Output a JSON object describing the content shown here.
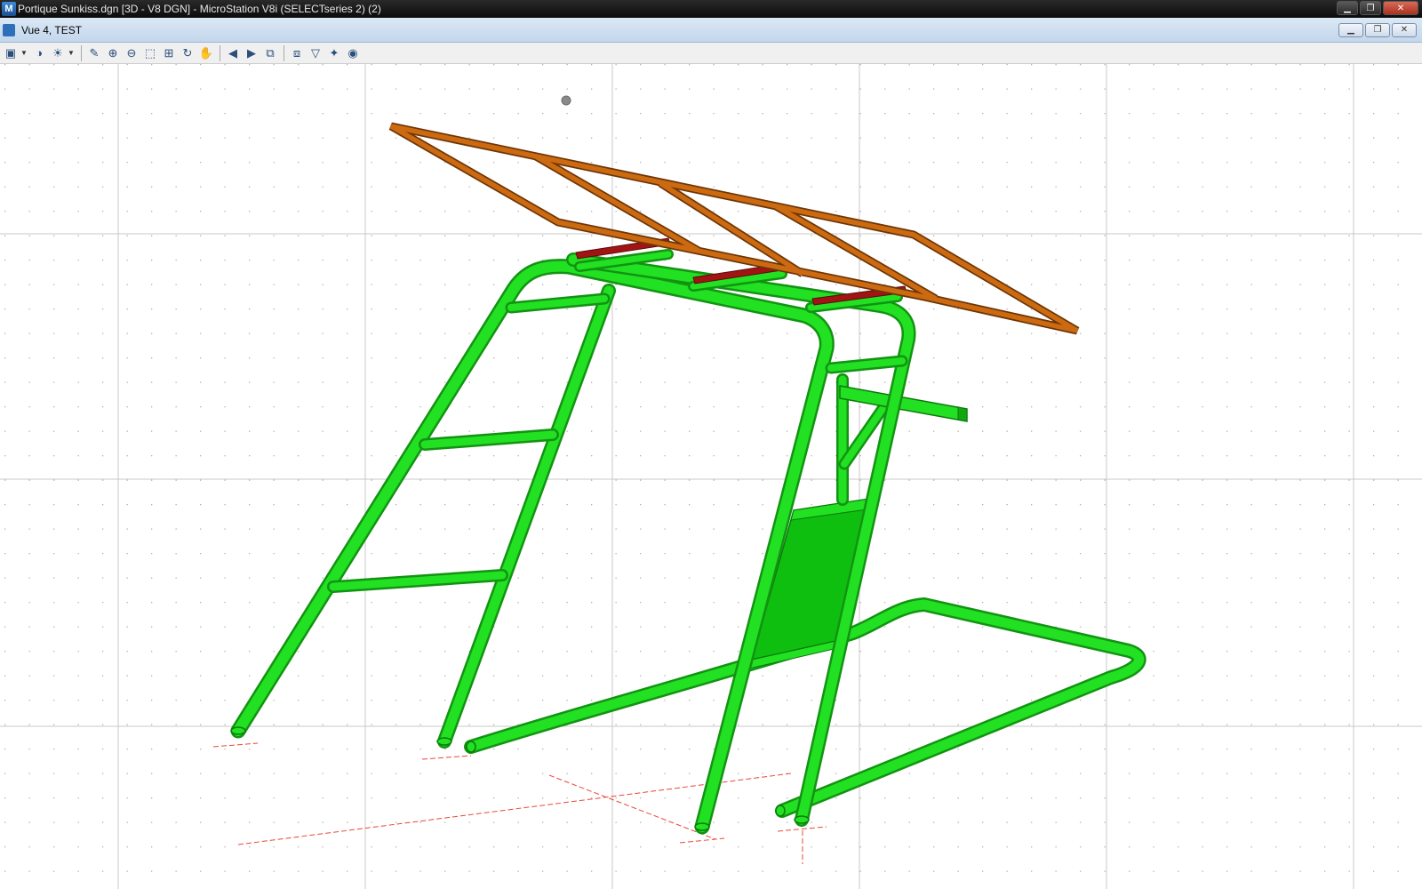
{
  "app": {
    "title": "Portique Sunkiss.dgn [3D - V8 DGN] - MicroStation V8i (SELECTseries 2) (2)",
    "icon": "microstation-logo-icon",
    "window_controls": [
      "minimize-icon",
      "restore-icon",
      "close-icon"
    ]
  },
  "view": {
    "title": "Vue 4, TEST",
    "icon": "view-window-icon",
    "window_controls": [
      "minimize-icon",
      "restore-icon",
      "close-icon"
    ]
  },
  "toolbar": {
    "tools": [
      "view-attributes-icon",
      "display-style-icon",
      "lighting-icon",
      "update-view-icon",
      "zoom-in-icon",
      "zoom-out-icon",
      "window-area-icon",
      "fit-view-icon",
      "rotate-view-icon",
      "pan-view-icon",
      "view-previous-icon",
      "view-next-icon",
      "copy-view-icon",
      "clip-volume-icon",
      "clip-mask-icon",
      "camera-icon",
      "render-icon"
    ]
  },
  "colors": {
    "frame_tube": "#22e022",
    "frame_tube_shade": "#129412",
    "roof_frame": "#cc6a12",
    "roof_bracket": "#a01414",
    "construction_lines": "#e8473a",
    "grid_major": "#c8c8c8",
    "grid_minor": "#b0b0b0"
  }
}
